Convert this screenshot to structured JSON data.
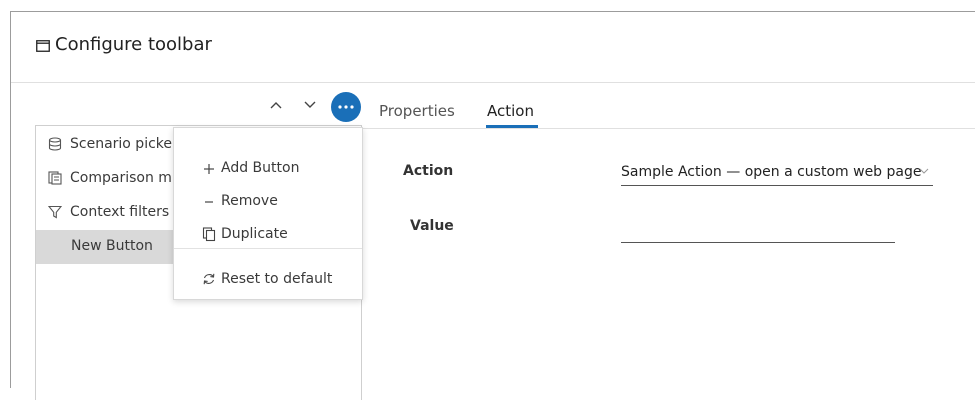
{
  "header": {
    "title": "Configure toolbar"
  },
  "tree": {
    "items": [
      {
        "label": "Scenario picke"
      },
      {
        "label": "Comparison m"
      },
      {
        "label": "Context filters"
      },
      {
        "label": "New Button"
      }
    ]
  },
  "menu": {
    "items": [
      {
        "label": "Add Button"
      },
      {
        "label": "Remove"
      },
      {
        "label": "Duplicate"
      },
      {
        "label": "Reset to default"
      }
    ]
  },
  "tabs": [
    {
      "label": "Properties"
    },
    {
      "label": "Action"
    }
  ],
  "form": {
    "action_label": "Action",
    "action_value": "Sample Action — open a custom web page",
    "value_label": "Value",
    "value_value": ""
  },
  "colors": {
    "accent": "#1a6fb8",
    "selected_row": "#d9d9d9"
  }
}
